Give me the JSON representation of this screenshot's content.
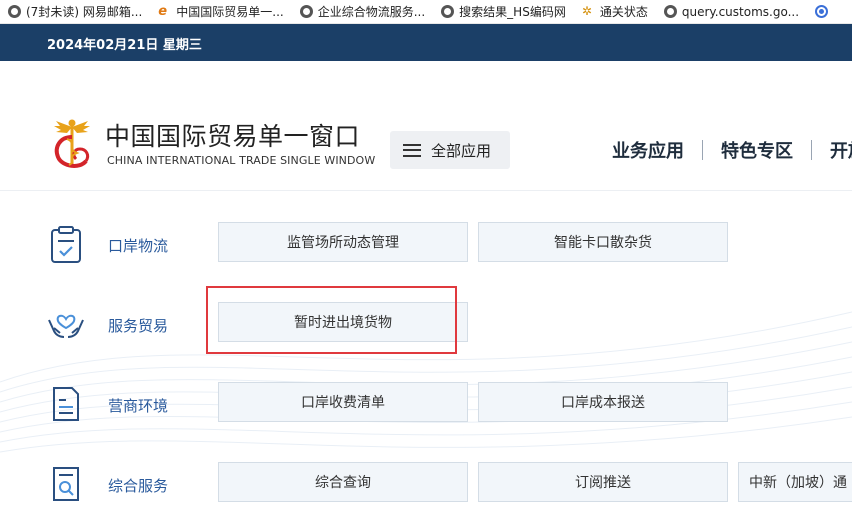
{
  "bookmarks": [
    {
      "label": "(7封未读) 网易邮箱...",
      "icon": "globe-icon"
    },
    {
      "label": "中国国际贸易单一...",
      "icon": "ie-icon"
    },
    {
      "label": "企业综合物流服务...",
      "icon": "globe-icon"
    },
    {
      "label": "搜索结果_HS编码网",
      "icon": "globe-icon"
    },
    {
      "label": "通关状态",
      "icon": "ant-icon"
    },
    {
      "label": "query.customs.go...",
      "icon": "globe-icon"
    },
    {
      "label": "",
      "icon": "radio-icon"
    }
  ],
  "date_bar": {
    "date": "2024年02月21日 星期三"
  },
  "header": {
    "site_name_cn": "中国国际贸易单一窗口",
    "site_name_en": "CHINA INTERNATIONAL TRADE SINGLE WINDOW",
    "all_apps_label": "全部应用",
    "nav": [
      "业务应用",
      "特色专区",
      "开放"
    ]
  },
  "categories": [
    {
      "label": "口岸物流",
      "icon": "clipboard-check-icon",
      "services": [
        "监管场所动态管理",
        "智能卡口散杂货"
      ]
    },
    {
      "label": "服务贸易",
      "icon": "hands-heart-icon",
      "services": [
        "暂时进出境货物"
      ]
    },
    {
      "label": "营商环境",
      "icon": "document-list-icon",
      "services": [
        "口岸收费清单",
        "口岸成本报送"
      ]
    },
    {
      "label": "综合服务",
      "icon": "document-search-icon",
      "services": [
        "综合查询",
        "订阅推送",
        "中新（加坡）通"
      ]
    }
  ],
  "colors": {
    "date_bar_bg": "#1b3f67",
    "category_text": "#2a5a9c",
    "highlight_border": "#e0393e",
    "service_bg": "#f2f6fa"
  }
}
